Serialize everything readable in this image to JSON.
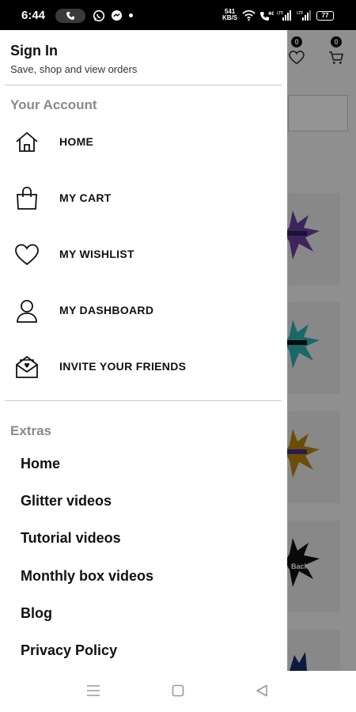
{
  "status_bar": {
    "time": "6:44",
    "speed_value": "541",
    "speed_unit": "KB/S",
    "battery": "77"
  },
  "background": {
    "wishlist_count": "0",
    "cart_count": "0",
    "card_badge_text": "Back"
  },
  "drawer": {
    "sign_in": {
      "title": "Sign In",
      "subtitle": "Save, shop and view orders"
    },
    "account_section": {
      "title": "Your Account",
      "items": [
        {
          "label": "HOME",
          "icon": "home-icon"
        },
        {
          "label": "MY CART",
          "icon": "shopping-bag-icon"
        },
        {
          "label": "MY WISHLIST",
          "icon": "heart-icon"
        },
        {
          "label": "MY DASHBOARD",
          "icon": "user-icon"
        },
        {
          "label": "INVITE YOUR FRIENDS",
          "icon": "invite-envelope-icon"
        }
      ]
    },
    "extras_section": {
      "title": "Extras",
      "items": [
        {
          "label": "Home"
        },
        {
          "label": "Glitter videos"
        },
        {
          "label": "Tutorial videos"
        },
        {
          "label": "Monthly box videos"
        },
        {
          "label": "Blog"
        },
        {
          "label": "Privacy Policy"
        }
      ]
    }
  },
  "colors": {
    "section_title": "#8a8a8a",
    "text": "#111111",
    "overlay": "rgba(0,0,0,0.42)"
  }
}
